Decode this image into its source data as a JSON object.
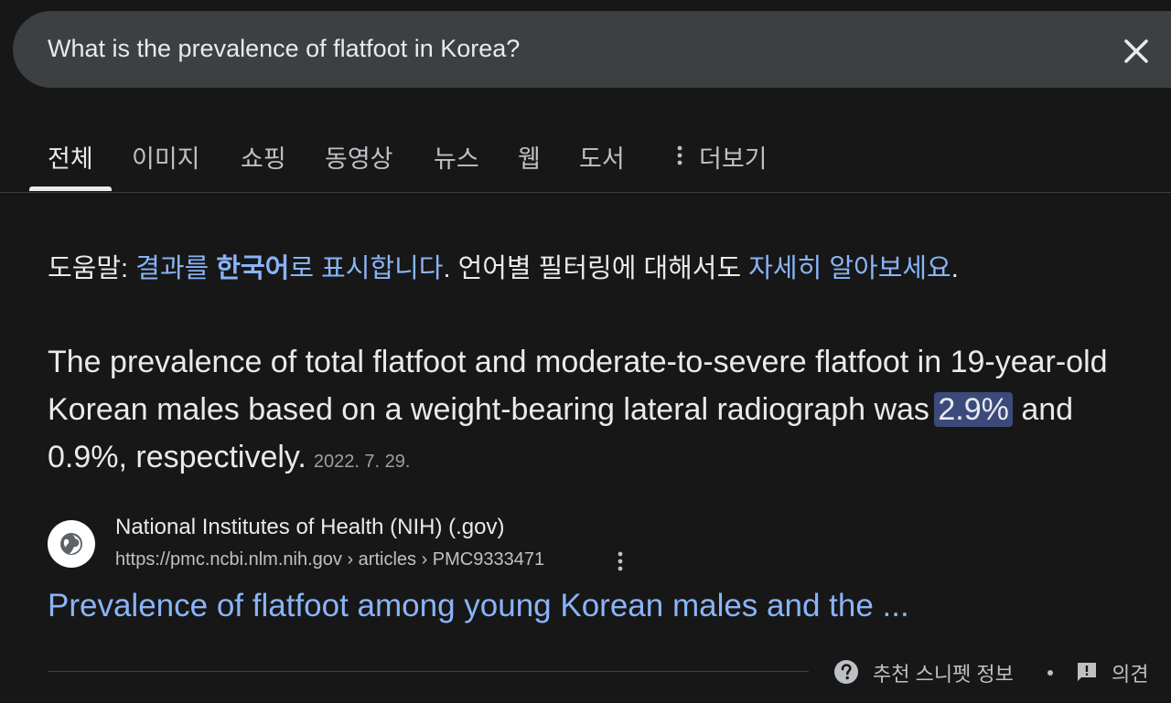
{
  "search": {
    "query": "What is the prevalence of flatfoot in Korea?"
  },
  "tabs": [
    {
      "label": "전체",
      "active": true
    },
    {
      "label": "이미지"
    },
    {
      "label": "쇼핑"
    },
    {
      "label": "동영상"
    },
    {
      "label": "뉴스"
    },
    {
      "label": "웹"
    },
    {
      "label": "도서"
    },
    {
      "label": "더보기"
    }
  ],
  "helper": {
    "prefix": "도움말: ",
    "link1_part1": "결과를 ",
    "link1_bold": "한국어",
    "link1_part2": "로 표시합니다",
    "mid": ". 언어별 필터링에 대해서도 ",
    "link2": "자세히 알아보세요",
    "suffix": "."
  },
  "answer": {
    "text_before": "The prevalence of total flatfoot and moderate-to-severe flatfoot in 19-year-old Korean males based on a weight-bearing lateral radiograph was ",
    "highlight": "2.9%",
    "text_after": " and 0.9%, respectively.",
    "date": "2022. 7. 29."
  },
  "source": {
    "name": "National Institutes of Health (NIH) (.gov)",
    "url": "https://pmc.ncbi.nlm.nih.gov › articles › PMC9333471",
    "icon": "globe-icon"
  },
  "result": {
    "title": "Prevalence of flatfoot among young Korean males and the ..."
  },
  "footer": {
    "snippet_label": "추천 스니펫 정보",
    "feedback_label": "의견"
  },
  "colors": {
    "background": "#171717",
    "link": "#8ab4f8",
    "highlight": "#3b4a7a",
    "search_bar": "#3c4043"
  }
}
